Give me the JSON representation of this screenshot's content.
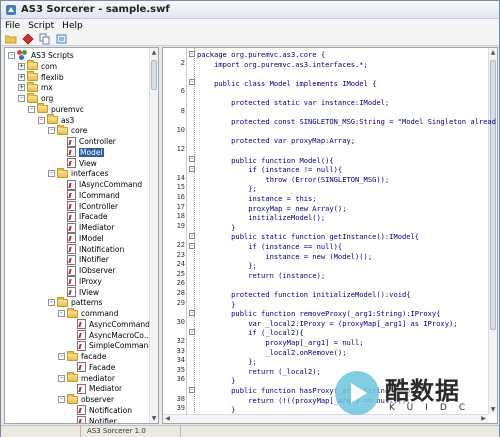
{
  "window": {
    "title": "AS3 Sorcerer - sample.swf"
  },
  "menu": [
    "File",
    "Script",
    "Help"
  ],
  "toolbar": [
    {
      "name": "open-icon",
      "color": "#e0a030"
    },
    {
      "name": "save-icon",
      "color": "#c02020"
    },
    {
      "name": "copy-icon",
      "color": "#6080b0"
    },
    {
      "name": "export-icon",
      "color": "#4080c0"
    }
  ],
  "tree": [
    {
      "label": "AS3 Scripts",
      "indent": 0,
      "type": "root",
      "exp": "-"
    },
    {
      "label": "com",
      "indent": 1,
      "type": "folder",
      "exp": "+"
    },
    {
      "label": "flexlib",
      "indent": 1,
      "type": "folder",
      "exp": "+"
    },
    {
      "label": "mx",
      "indent": 1,
      "type": "folder",
      "exp": "+"
    },
    {
      "label": "org",
      "indent": 1,
      "type": "folder",
      "exp": "-"
    },
    {
      "label": "puremvc",
      "indent": 2,
      "type": "folder",
      "exp": "-"
    },
    {
      "label": "as3",
      "indent": 3,
      "type": "folder",
      "exp": "-"
    },
    {
      "label": "core",
      "indent": 4,
      "type": "folder",
      "exp": "-"
    },
    {
      "label": "Controller",
      "indent": 5,
      "type": "file"
    },
    {
      "label": "Model",
      "indent": 5,
      "type": "file",
      "selected": true
    },
    {
      "label": "View",
      "indent": 5,
      "type": "file"
    },
    {
      "label": "interfaces",
      "indent": 4,
      "type": "folder",
      "exp": "-"
    },
    {
      "label": "IAsyncCommand",
      "indent": 5,
      "type": "file"
    },
    {
      "label": "ICommand",
      "indent": 5,
      "type": "file"
    },
    {
      "label": "IController",
      "indent": 5,
      "type": "file"
    },
    {
      "label": "IFacade",
      "indent": 5,
      "type": "file"
    },
    {
      "label": "IMediator",
      "indent": 5,
      "type": "file"
    },
    {
      "label": "IModel",
      "indent": 5,
      "type": "file"
    },
    {
      "label": "INotification",
      "indent": 5,
      "type": "file"
    },
    {
      "label": "INotifier",
      "indent": 5,
      "type": "file"
    },
    {
      "label": "IObserver",
      "indent": 5,
      "type": "file"
    },
    {
      "label": "IProxy",
      "indent": 5,
      "type": "file"
    },
    {
      "label": "IView",
      "indent": 5,
      "type": "file"
    },
    {
      "label": "patterns",
      "indent": 4,
      "type": "folder",
      "exp": "-"
    },
    {
      "label": "command",
      "indent": 5,
      "type": "folder",
      "exp": "-"
    },
    {
      "label": "AsyncCommand",
      "indent": 6,
      "type": "file"
    },
    {
      "label": "AsyncMacroCo...",
      "indent": 6,
      "type": "file"
    },
    {
      "label": "SimpleCommand",
      "indent": 6,
      "type": "file"
    },
    {
      "label": "facade",
      "indent": 5,
      "type": "folder",
      "exp": "-"
    },
    {
      "label": "Facade",
      "indent": 6,
      "type": "file"
    },
    {
      "label": "mediator",
      "indent": 5,
      "type": "folder",
      "exp": "-"
    },
    {
      "label": "Mediator",
      "indent": 6,
      "type": "file"
    },
    {
      "label": "observer",
      "indent": 5,
      "type": "folder",
      "exp": "-"
    },
    {
      "label": "Notification",
      "indent": 6,
      "type": "file"
    },
    {
      "label": "Notifier",
      "indent": 6,
      "type": "file"
    }
  ],
  "code": [
    {
      "ln": "",
      "fold": "-",
      "text": "package org.puremvc.as3.core {"
    },
    {
      "ln": "2",
      "fold": "",
      "text": "    import org.puremvc.as3.interfaces.*;"
    },
    {
      "ln": "",
      "fold": "",
      "text": ""
    },
    {
      "ln": "",
      "fold": "-",
      "text": "    public class Model implements IModel {"
    },
    {
      "ln": "6",
      "fold": "",
      "text": ""
    },
    {
      "ln": "",
      "fold": "",
      "text": "        protected static var instance:IModel;"
    },
    {
      "ln": "8",
      "fold": "",
      "text": ""
    },
    {
      "ln": "",
      "fold": "",
      "text": "        protected const SINGLETON_MSG:String = \"Model Singleton alread"
    },
    {
      "ln": "10",
      "fold": "",
      "text": ""
    },
    {
      "ln": "",
      "fold": "",
      "text": "        protected var proxyMap:Array;"
    },
    {
      "ln": "12",
      "fold": "",
      "text": ""
    },
    {
      "ln": "",
      "fold": "-",
      "text": "        public function Model(){"
    },
    {
      "ln": "",
      "fold": "-",
      "text": "            if (instance != null){"
    },
    {
      "ln": "14",
      "fold": "",
      "text": "                throw (Error(SINGLETON_MSG));"
    },
    {
      "ln": "15",
      "fold": "",
      "text": "            };"
    },
    {
      "ln": "16",
      "fold": "",
      "text": "            instance = this;"
    },
    {
      "ln": "17",
      "fold": "",
      "text": "            proxyMap = new Array();"
    },
    {
      "ln": "18",
      "fold": "",
      "text": "            initializeModel();"
    },
    {
      "ln": "19",
      "fold": "",
      "text": "        }"
    },
    {
      "ln": "",
      "fold": "-",
      "text": "        public static function getInstance():IModel{"
    },
    {
      "ln": "22",
      "fold": "-",
      "text": "            if (instance == null){"
    },
    {
      "ln": "23",
      "fold": "",
      "text": "                instance = new (Model)();"
    },
    {
      "ln": "24",
      "fold": "",
      "text": "            };"
    },
    {
      "ln": "25",
      "fold": "",
      "text": "            return (instance);"
    },
    {
      "ln": "26",
      "fold": "",
      "text": ""
    },
    {
      "ln": "28",
      "fold": "",
      "text": "        protected function initializeModel():void{"
    },
    {
      "ln": "29",
      "fold": "",
      "text": "        }"
    },
    {
      "ln": "",
      "fold": "-",
      "text": "        public function removeProxy(_arg1:String):IProxy{"
    },
    {
      "ln": "30",
      "fold": "",
      "text": "            var _local2:IProxy = (proxyMap[_arg1] as IProxy);"
    },
    {
      "ln": "",
      "fold": "-",
      "text": "            if (_local2){"
    },
    {
      "ln": "32",
      "fold": "",
      "text": "                proxyMap[_arg1] = null;"
    },
    {
      "ln": "33",
      "fold": "",
      "text": "                _local2.onRemove();"
    },
    {
      "ln": "34",
      "fold": "",
      "text": "            };"
    },
    {
      "ln": "35",
      "fold": "",
      "text": "            return (_local2);"
    },
    {
      "ln": "36",
      "fold": "",
      "text": "        }"
    },
    {
      "ln": "",
      "fold": "-",
      "text": "        public function hasProxy(_arg1:String):Boolean{"
    },
    {
      "ln": "38",
      "fold": "",
      "text": "            return (!((proxyMap[_arg1] == null)));"
    },
    {
      "ln": "39",
      "fold": "",
      "text": "        }"
    }
  ],
  "statusbar": {
    "version": "AS3 Sorcerer 1.0"
  },
  "watermark": {
    "text_cn": "酷数据",
    "text_en": "KUIDC"
  }
}
